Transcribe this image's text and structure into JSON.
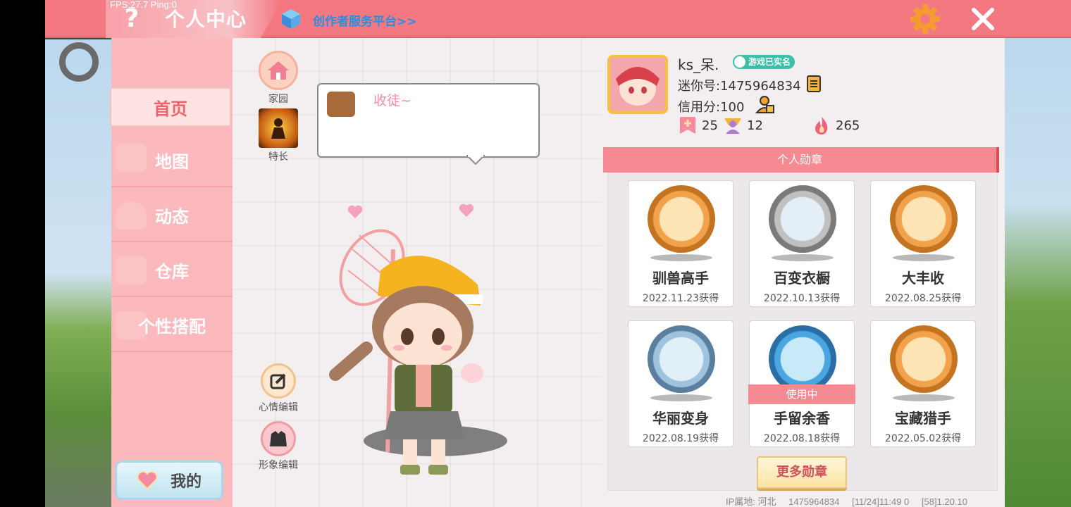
{
  "debug": {
    "fps_text": "FPS:27.7  Ping:0"
  },
  "header": {
    "title": "个人中心",
    "creator_link": "创作者服务平台>>",
    "help": "?"
  },
  "sidebar": {
    "items": [
      {
        "label": "首页",
        "active": true
      },
      {
        "label": "地图"
      },
      {
        "label": "动态"
      },
      {
        "label": "仓库"
      },
      {
        "label": "个性搭配"
      }
    ],
    "mine_label": "我的"
  },
  "center": {
    "home_label": "家园",
    "talent_label": "特长",
    "speech_text": "收徒~",
    "mood_edit_label": "心情编辑",
    "image_edit_label": "形象编辑"
  },
  "profile": {
    "nickname": "ks_呆.",
    "verified_label": "游戏已实名",
    "mini_id": "迷你号:1475964834",
    "credit": "信用分:100",
    "stats": [
      {
        "icon": "plus-badge-icon",
        "value": "25"
      },
      {
        "icon": "trophy-person-icon",
        "value": "12"
      },
      {
        "icon": "flame-icon",
        "value": "265"
      }
    ]
  },
  "badges": {
    "header": "个人勋章",
    "items": [
      {
        "name": "驯兽高手",
        "date": "2022.11.23获得",
        "color": "#f2a24a"
      },
      {
        "name": "百变衣橱",
        "date": "2022.10.13获得",
        "color": "#b8b8b8"
      },
      {
        "name": "大丰收",
        "date": "2022.08.25获得",
        "color": "#f2a24a"
      },
      {
        "name": "华丽变身",
        "date": "2022.08.19获得",
        "color": "#8fb6d8"
      },
      {
        "name": "手留余香",
        "date": "2022.08.18获得",
        "color": "#4aa6e0",
        "in_use": "使用中"
      },
      {
        "name": "宝藏猎手",
        "date": "2022.05.02获得",
        "color": "#f2a24a"
      }
    ],
    "more_label": "更多勋章"
  },
  "footer": {
    "ip": "IP属地: 河北",
    "uid": "1475964834",
    "time": "[11/24]11:49 0",
    "version": "[58]1.20.10"
  }
}
